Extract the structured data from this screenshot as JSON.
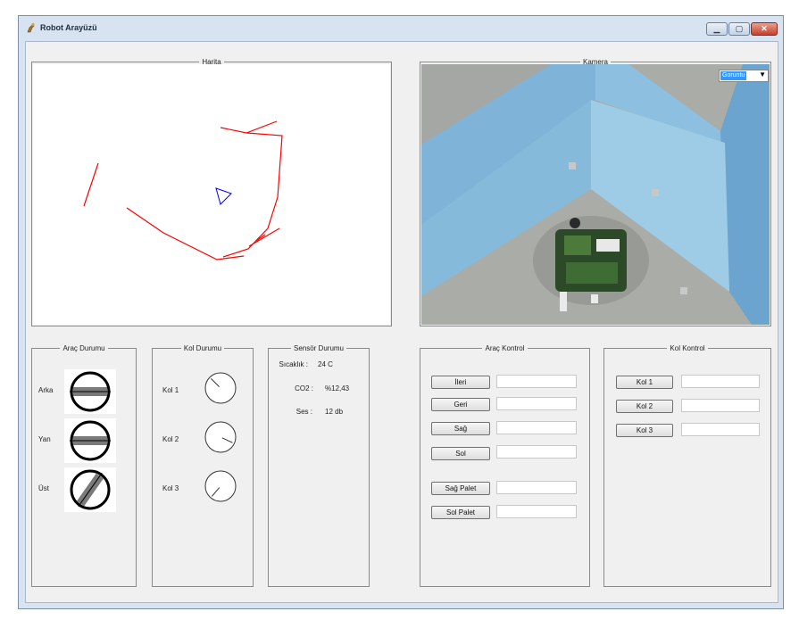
{
  "window": {
    "title": "Robot Arayüzü",
    "minimize_glyph": "▁",
    "maximize_glyph": "▢",
    "close_glyph": "✕"
  },
  "map": {
    "title": "Harita",
    "wall_color": "#ff0000",
    "robot_color": "#0000ff"
  },
  "camera": {
    "title": "Kamera",
    "selected": "Goruntu",
    "dropdown_arrow": "▼"
  },
  "vehicle_status": {
    "title": "Araç Durumu",
    "items": [
      {
        "label": "Arka",
        "angle": 0
      },
      {
        "label": "Yan",
        "angle": 0
      },
      {
        "label": "Üst",
        "angle": -55
      }
    ]
  },
  "arm_status": {
    "title": "Kol Durumu",
    "items": [
      {
        "label": "Kol 1",
        "angle": 135
      },
      {
        "label": "Kol 2",
        "angle": -25
      },
      {
        "label": "Kol 3",
        "angle": -130
      }
    ]
  },
  "sensor_status": {
    "title": "Sensör Durumu",
    "rows": [
      {
        "label": "Sıcaklık :",
        "value": "24 C"
      },
      {
        "label": "CO2 :",
        "value": "%12,43"
      },
      {
        "label": "Ses :",
        "value": "12 db"
      }
    ]
  },
  "vehicle_control": {
    "title": "Araç Kontrol",
    "buttons": [
      "İleri",
      "Geri",
      "Sağ",
      "Sol",
      "Sağ Palet",
      "Sol Palet"
    ]
  },
  "arm_control": {
    "title": "Kol Kontrol",
    "buttons": [
      "Kol 1",
      "Kol 2",
      "Kol 3"
    ]
  }
}
